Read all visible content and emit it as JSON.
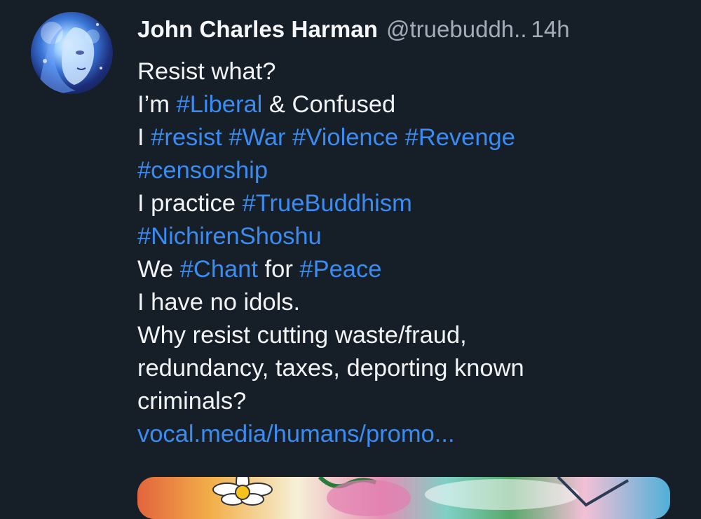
{
  "post": {
    "author": {
      "display_name": "John Charles Harman",
      "handle": "@truebuddh..",
      "avatar_icon": "avatar-portrait"
    },
    "time": "14h",
    "lines": [
      [
        {
          "t": "Resist what?"
        }
      ],
      [
        {
          "t": "I’m "
        },
        {
          "t": "#Liberal",
          "tag": true
        },
        {
          "t": " & Confused"
        }
      ],
      [
        {
          "t": "I "
        },
        {
          "t": "#resist",
          "tag": true
        },
        {
          "t": " "
        },
        {
          "t": "#War",
          "tag": true
        },
        {
          "t": " "
        },
        {
          "t": "#Violence",
          "tag": true
        },
        {
          "t": " "
        },
        {
          "t": "#Revenge",
          "tag": true
        }
      ],
      [
        {
          "t": "#censorship",
          "tag": true
        }
      ],
      [
        {
          "t": "I practice "
        },
        {
          "t": "#TrueBuddhism",
          "tag": true
        }
      ],
      [
        {
          "t": "#NichirenShoshu",
          "tag": true
        }
      ],
      [
        {
          "t": "We "
        },
        {
          "t": "#Chant",
          "tag": true
        },
        {
          "t": " for "
        },
        {
          "t": "#Peace",
          "tag": true
        }
      ],
      [
        {
          "t": "I have no idols."
        }
      ],
      [
        {
          "t": "Why resist cutting waste/fraud,"
        }
      ],
      [
        {
          "t": "redundancy, taxes, deporting known"
        }
      ],
      [
        {
          "t": "criminals?"
        }
      ]
    ],
    "link": "vocal.media/humans/promo...",
    "media_icon": "embedded-image"
  },
  "colors": {
    "background": "#161e27",
    "text": "#f1f3f5",
    "muted": "#a3adba",
    "accent": "#3b8cf2"
  }
}
